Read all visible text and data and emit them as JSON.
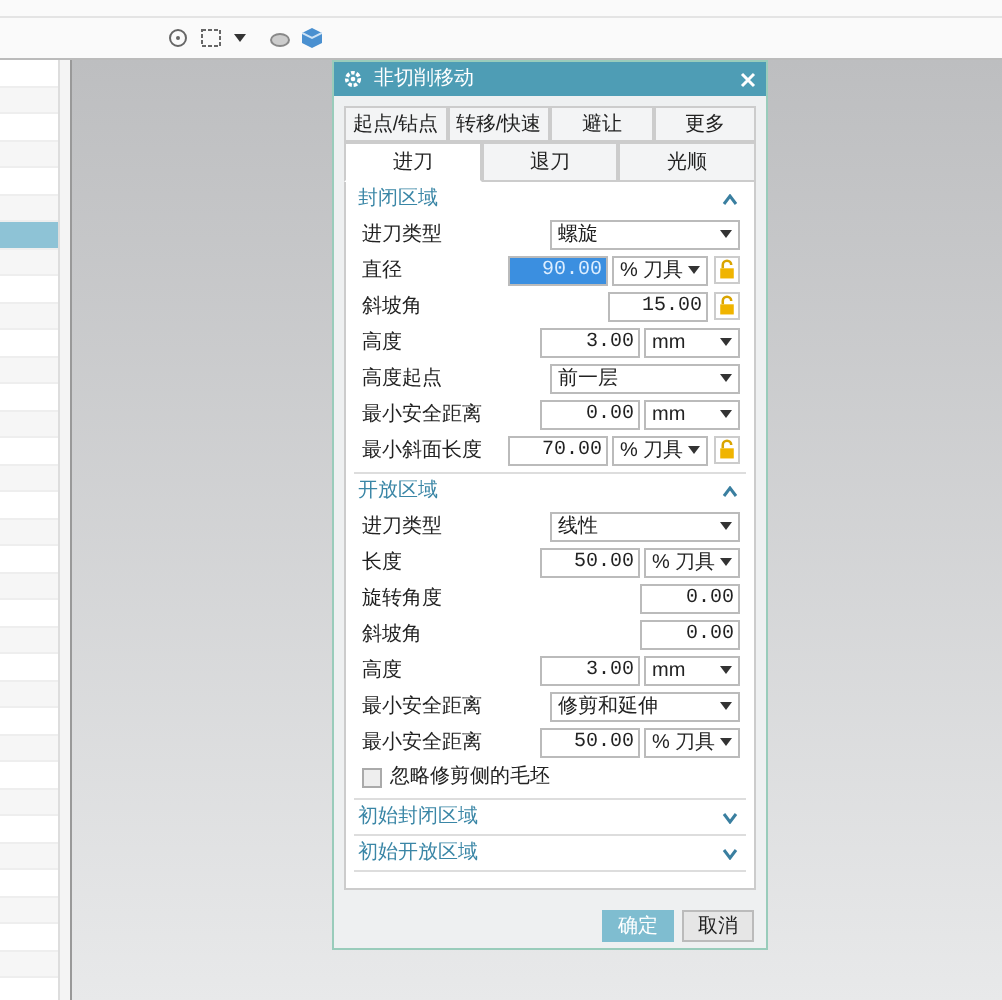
{
  "left_panel": {
    "rows": [
      {
        "selected": false
      },
      {
        "selected": false
      },
      {
        "selected": false
      },
      {
        "selected": false
      },
      {
        "selected": false
      },
      {
        "selected": false
      },
      {
        "selected": true
      },
      {
        "selected": false
      },
      {
        "selected": false
      },
      {
        "selected": false
      },
      {
        "selected": false
      },
      {
        "selected": false
      },
      {
        "selected": false
      },
      {
        "selected": false
      },
      {
        "selected": false
      },
      {
        "selected": false
      },
      {
        "selected": false
      },
      {
        "selected": false
      },
      {
        "selected": false
      },
      {
        "selected": false
      },
      {
        "selected": false
      },
      {
        "selected": false
      },
      {
        "selected": false
      },
      {
        "selected": false
      },
      {
        "selected": false
      },
      {
        "selected": false
      },
      {
        "selected": false
      },
      {
        "selected": false
      },
      {
        "selected": false
      },
      {
        "selected": false
      },
      {
        "selected": false
      },
      {
        "selected": false
      },
      {
        "selected": false
      },
      {
        "selected": false
      }
    ]
  },
  "dialog": {
    "title": "非切削移动",
    "tabs_row_1": [
      {
        "label": "起点/钻点",
        "selected": false
      },
      {
        "label": "转移/快速",
        "selected": false
      },
      {
        "label": "避让",
        "selected": false
      },
      {
        "label": "更多",
        "selected": false
      }
    ],
    "tabs_row_2": [
      {
        "label": "进刀",
        "selected": true
      },
      {
        "label": "退刀",
        "selected": false
      },
      {
        "label": "光顺",
        "selected": false
      }
    ],
    "sections": [
      {
        "title": "封闭区域",
        "expanded": true,
        "rows": [
          {
            "kind": "dropdown",
            "label": "进刀类型",
            "value": "螺旋"
          },
          {
            "kind": "number",
            "label": "直径",
            "value": "90.00",
            "selected": true,
            "unit": "% 刀具",
            "lock": true
          },
          {
            "kind": "number",
            "label": "斜坡角",
            "value": "15.00",
            "selected": false,
            "lock": true
          },
          {
            "kind": "number",
            "label": "高度",
            "value": "3.00",
            "selected": false,
            "unit": "mm"
          },
          {
            "kind": "dropdown",
            "label": "高度起点",
            "value": "前一层"
          },
          {
            "kind": "number",
            "label": "最小安全距离",
            "value": "0.00",
            "selected": false,
            "unit": "mm"
          },
          {
            "kind": "number",
            "label": "最小斜面长度",
            "value": "70.00",
            "selected": false,
            "unit": "% 刀具",
            "lock": true
          }
        ]
      },
      {
        "title": "开放区域",
        "expanded": true,
        "rows": [
          {
            "kind": "dropdown",
            "label": "进刀类型",
            "value": "线性"
          },
          {
            "kind": "number",
            "label": "长度",
            "value": "50.00",
            "selected": false,
            "unit": "% 刀具"
          },
          {
            "kind": "number",
            "label": "旋转角度",
            "value": "0.00",
            "selected": false
          },
          {
            "kind": "number",
            "label": "斜坡角",
            "value": "0.00",
            "selected": false
          },
          {
            "kind": "number",
            "label": "高度",
            "value": "3.00",
            "selected": false,
            "unit": "mm"
          },
          {
            "kind": "dropdown",
            "label": "最小安全距离",
            "value": "修剪和延伸"
          },
          {
            "kind": "number",
            "label": "最小安全距离",
            "value": "50.00",
            "selected": false,
            "unit": "% 刀具"
          },
          {
            "kind": "checkbox",
            "label": "忽略修剪侧的毛坯",
            "checked": false
          }
        ]
      },
      {
        "title": "初始封闭区域",
        "expanded": false
      },
      {
        "title": "初始开放区域",
        "expanded": false
      }
    ],
    "buttons": [
      {
        "label": "确定",
        "kind": "primary"
      },
      {
        "label": "取消",
        "kind": "secondary"
      }
    ]
  }
}
